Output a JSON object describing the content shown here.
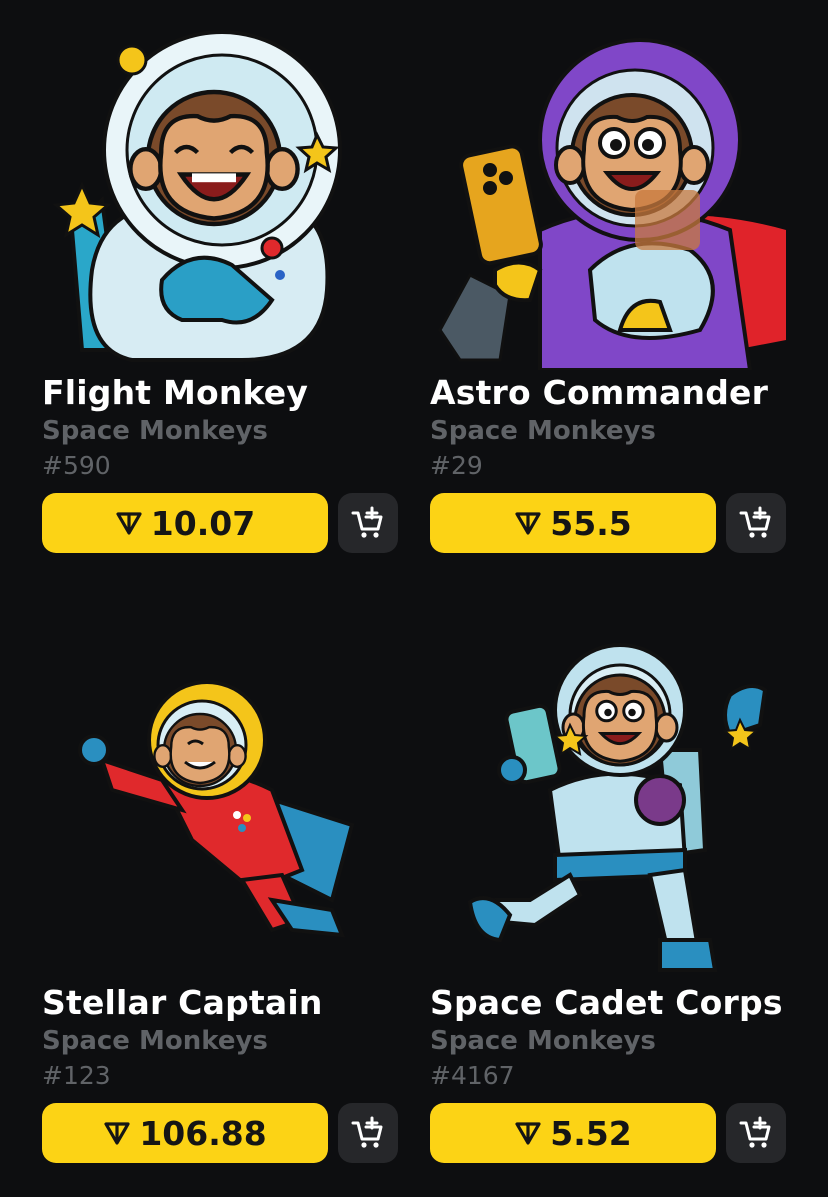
{
  "cards": [
    {
      "title": "Flight Monkey",
      "collection": "Space Monkeys",
      "number": "#590",
      "price": "10.07"
    },
    {
      "title": "Astro Commander",
      "collection": "Space Monkeys",
      "number": "#29",
      "price": "55.5"
    },
    {
      "title": "Stellar Captain",
      "collection": "Space Monkeys",
      "number": "#123",
      "price": "106.88"
    },
    {
      "title": "Space Cadet Corps",
      "collection": "Space Monkeys",
      "number": "#4167",
      "price": "5.52"
    }
  ],
  "icons": {
    "currency": "ton-icon",
    "cart": "add-to-cart-icon"
  },
  "colors": {
    "background": "#0d0e10",
    "price_button": "#fcd315",
    "cart_button": "#26272a",
    "muted_text": "#606367"
  }
}
